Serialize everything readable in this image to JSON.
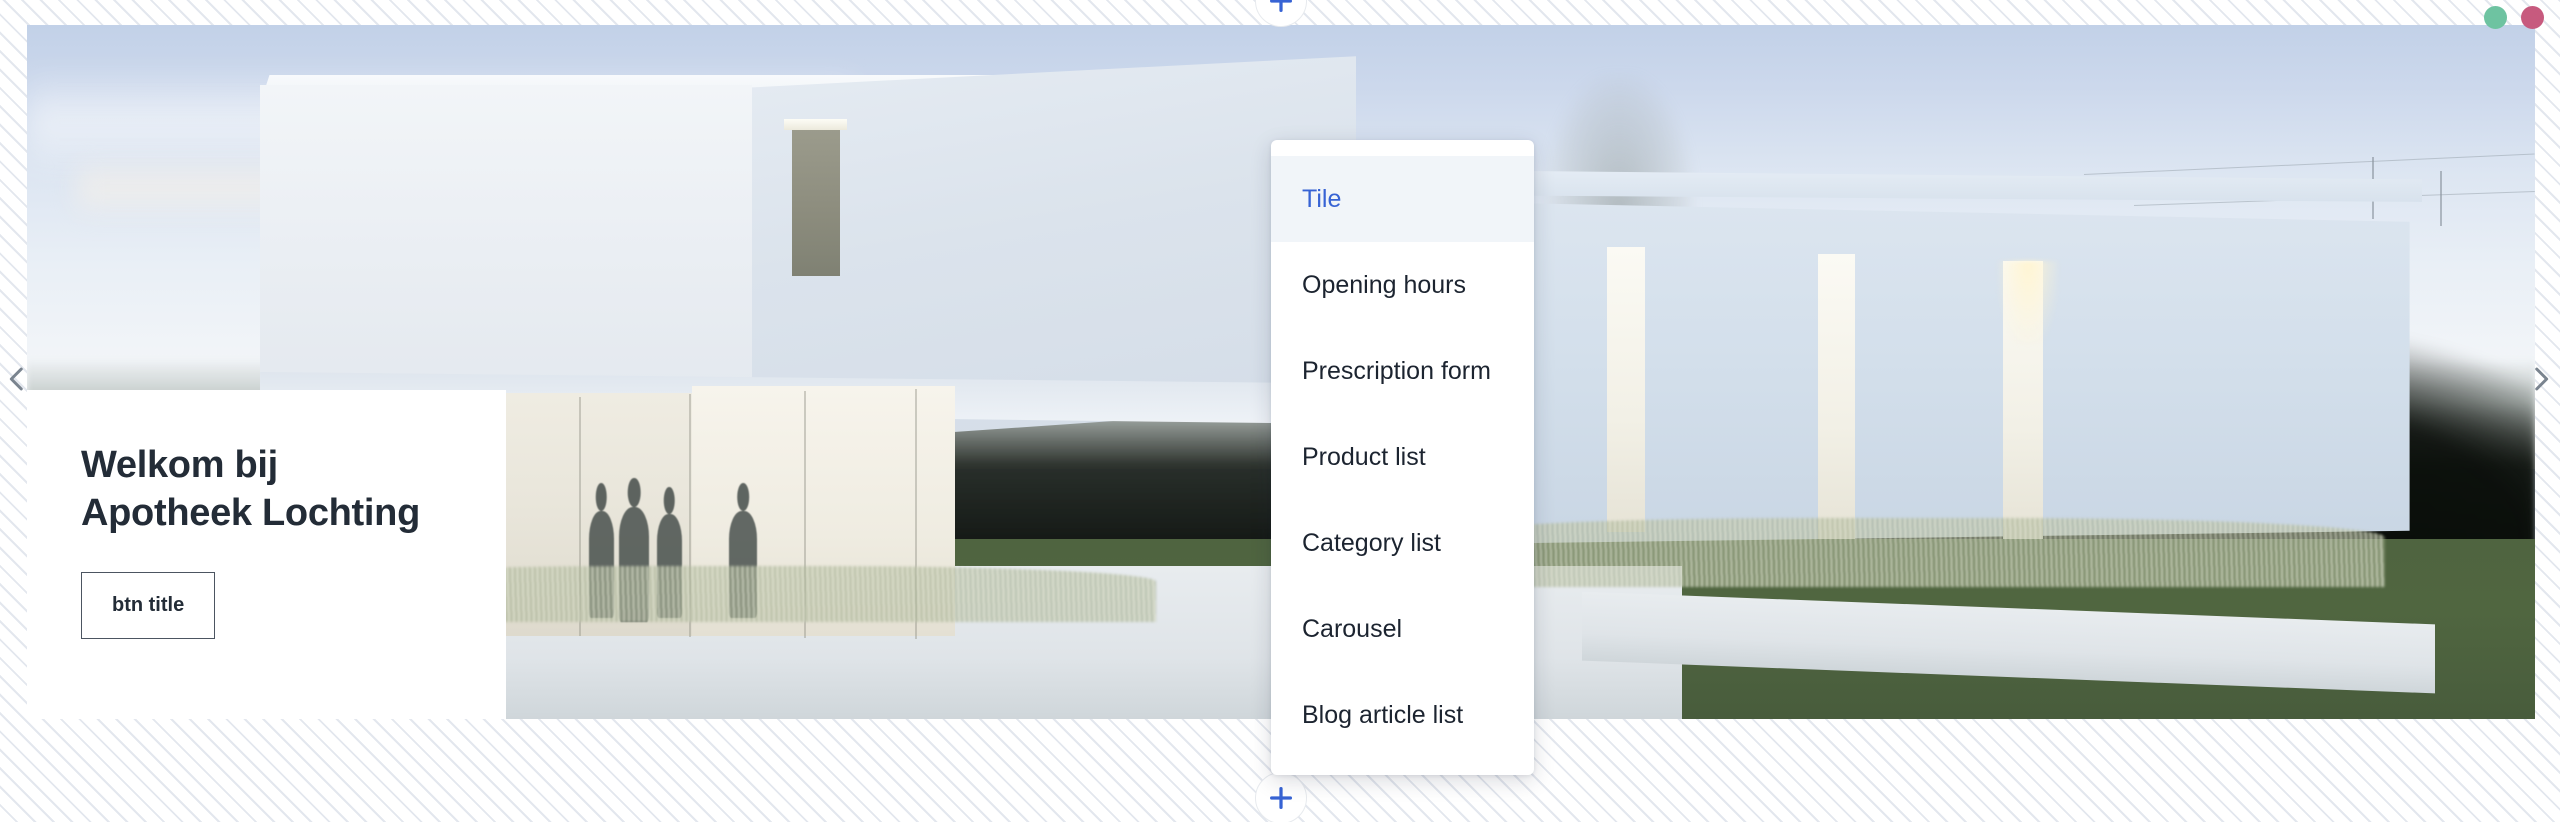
{
  "hero": {
    "headline": "Welkom bij\nApotheek Lochting",
    "cta_label": "btn title",
    "image_alt": "pharmacy-building-rendering"
  },
  "carousel": {
    "prev_icon": "chevron-left-icon",
    "next_icon": "chevron-right-icon"
  },
  "add_blocks": {
    "top_icon": "plus-icon",
    "bottom_icon": "plus-icon",
    "accent_color": "#3763d4"
  },
  "status_dots": [
    {
      "name": "status-dot-green",
      "color": "#6ec3a1"
    },
    {
      "name": "status-dot-red",
      "color": "#c75a7e"
    }
  ],
  "block_menu": {
    "selected_color": "#3763d4",
    "highlight_bg": "#f1f5f9",
    "items": [
      {
        "label": "Tile",
        "selected": true
      },
      {
        "label": "Opening hours",
        "selected": false
      },
      {
        "label": "Prescription form",
        "selected": false
      },
      {
        "label": "Product list",
        "selected": false
      },
      {
        "label": "Category list",
        "selected": false
      },
      {
        "label": "Carousel",
        "selected": false
      },
      {
        "label": "Blog article list",
        "selected": false
      }
    ]
  }
}
